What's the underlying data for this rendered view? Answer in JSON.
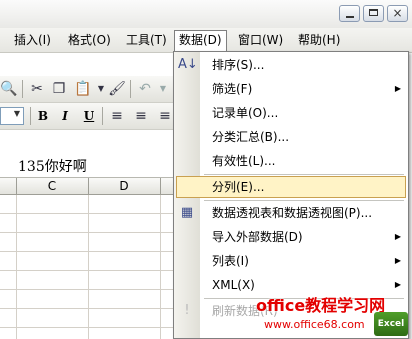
{
  "menubar": {
    "items": [
      {
        "label": "插入(I)"
      },
      {
        "label": "格式(O)"
      },
      {
        "label": "工具(T)"
      },
      {
        "label": "数据(D)"
      },
      {
        "label": "窗口(W)"
      },
      {
        "label": "帮助(H)"
      }
    ]
  },
  "window": {
    "close_glyph": "×"
  },
  "formula_bar": {
    "value": "135你好啊"
  },
  "columns": [
    "C",
    "D"
  ],
  "toolbar": {
    "bold": "B",
    "italic": "I",
    "underline": "U"
  },
  "data_menu": {
    "items": [
      {
        "label": "排序(S)...",
        "icon": "sort-az-icon",
        "submenu": false,
        "enabled": true
      },
      {
        "label": "筛选(F)",
        "submenu": true,
        "enabled": true
      },
      {
        "label": "记录单(O)...",
        "submenu": false,
        "enabled": true
      },
      {
        "label": "分类汇总(B)...",
        "submenu": false,
        "enabled": true
      },
      {
        "label": "有效性(L)...",
        "submenu": false,
        "enabled": true
      },
      {
        "label": "分列(E)...",
        "submenu": false,
        "enabled": true,
        "highlighted": true
      },
      {
        "label": "数据透视表和数据透视图(P)...",
        "icon": "pivot-table-icon",
        "submenu": false,
        "enabled": true
      },
      {
        "label": "导入外部数据(D)",
        "submenu": true,
        "enabled": true
      },
      {
        "label": "列表(I)",
        "submenu": true,
        "enabled": true
      },
      {
        "label": "XML(X)",
        "submenu": true,
        "enabled": true
      },
      {
        "label": "刷新数据(R)",
        "icon": "refresh-data-icon",
        "submenu": false,
        "enabled": false
      }
    ]
  },
  "watermark": {
    "line1": "office教程学习网",
    "line2": "www.office68.com",
    "logo": "Excel"
  },
  "colors": {
    "highlight_bg": "#fff3c6",
    "highlight_border": "#c9a050",
    "watermark": "#e30000"
  }
}
